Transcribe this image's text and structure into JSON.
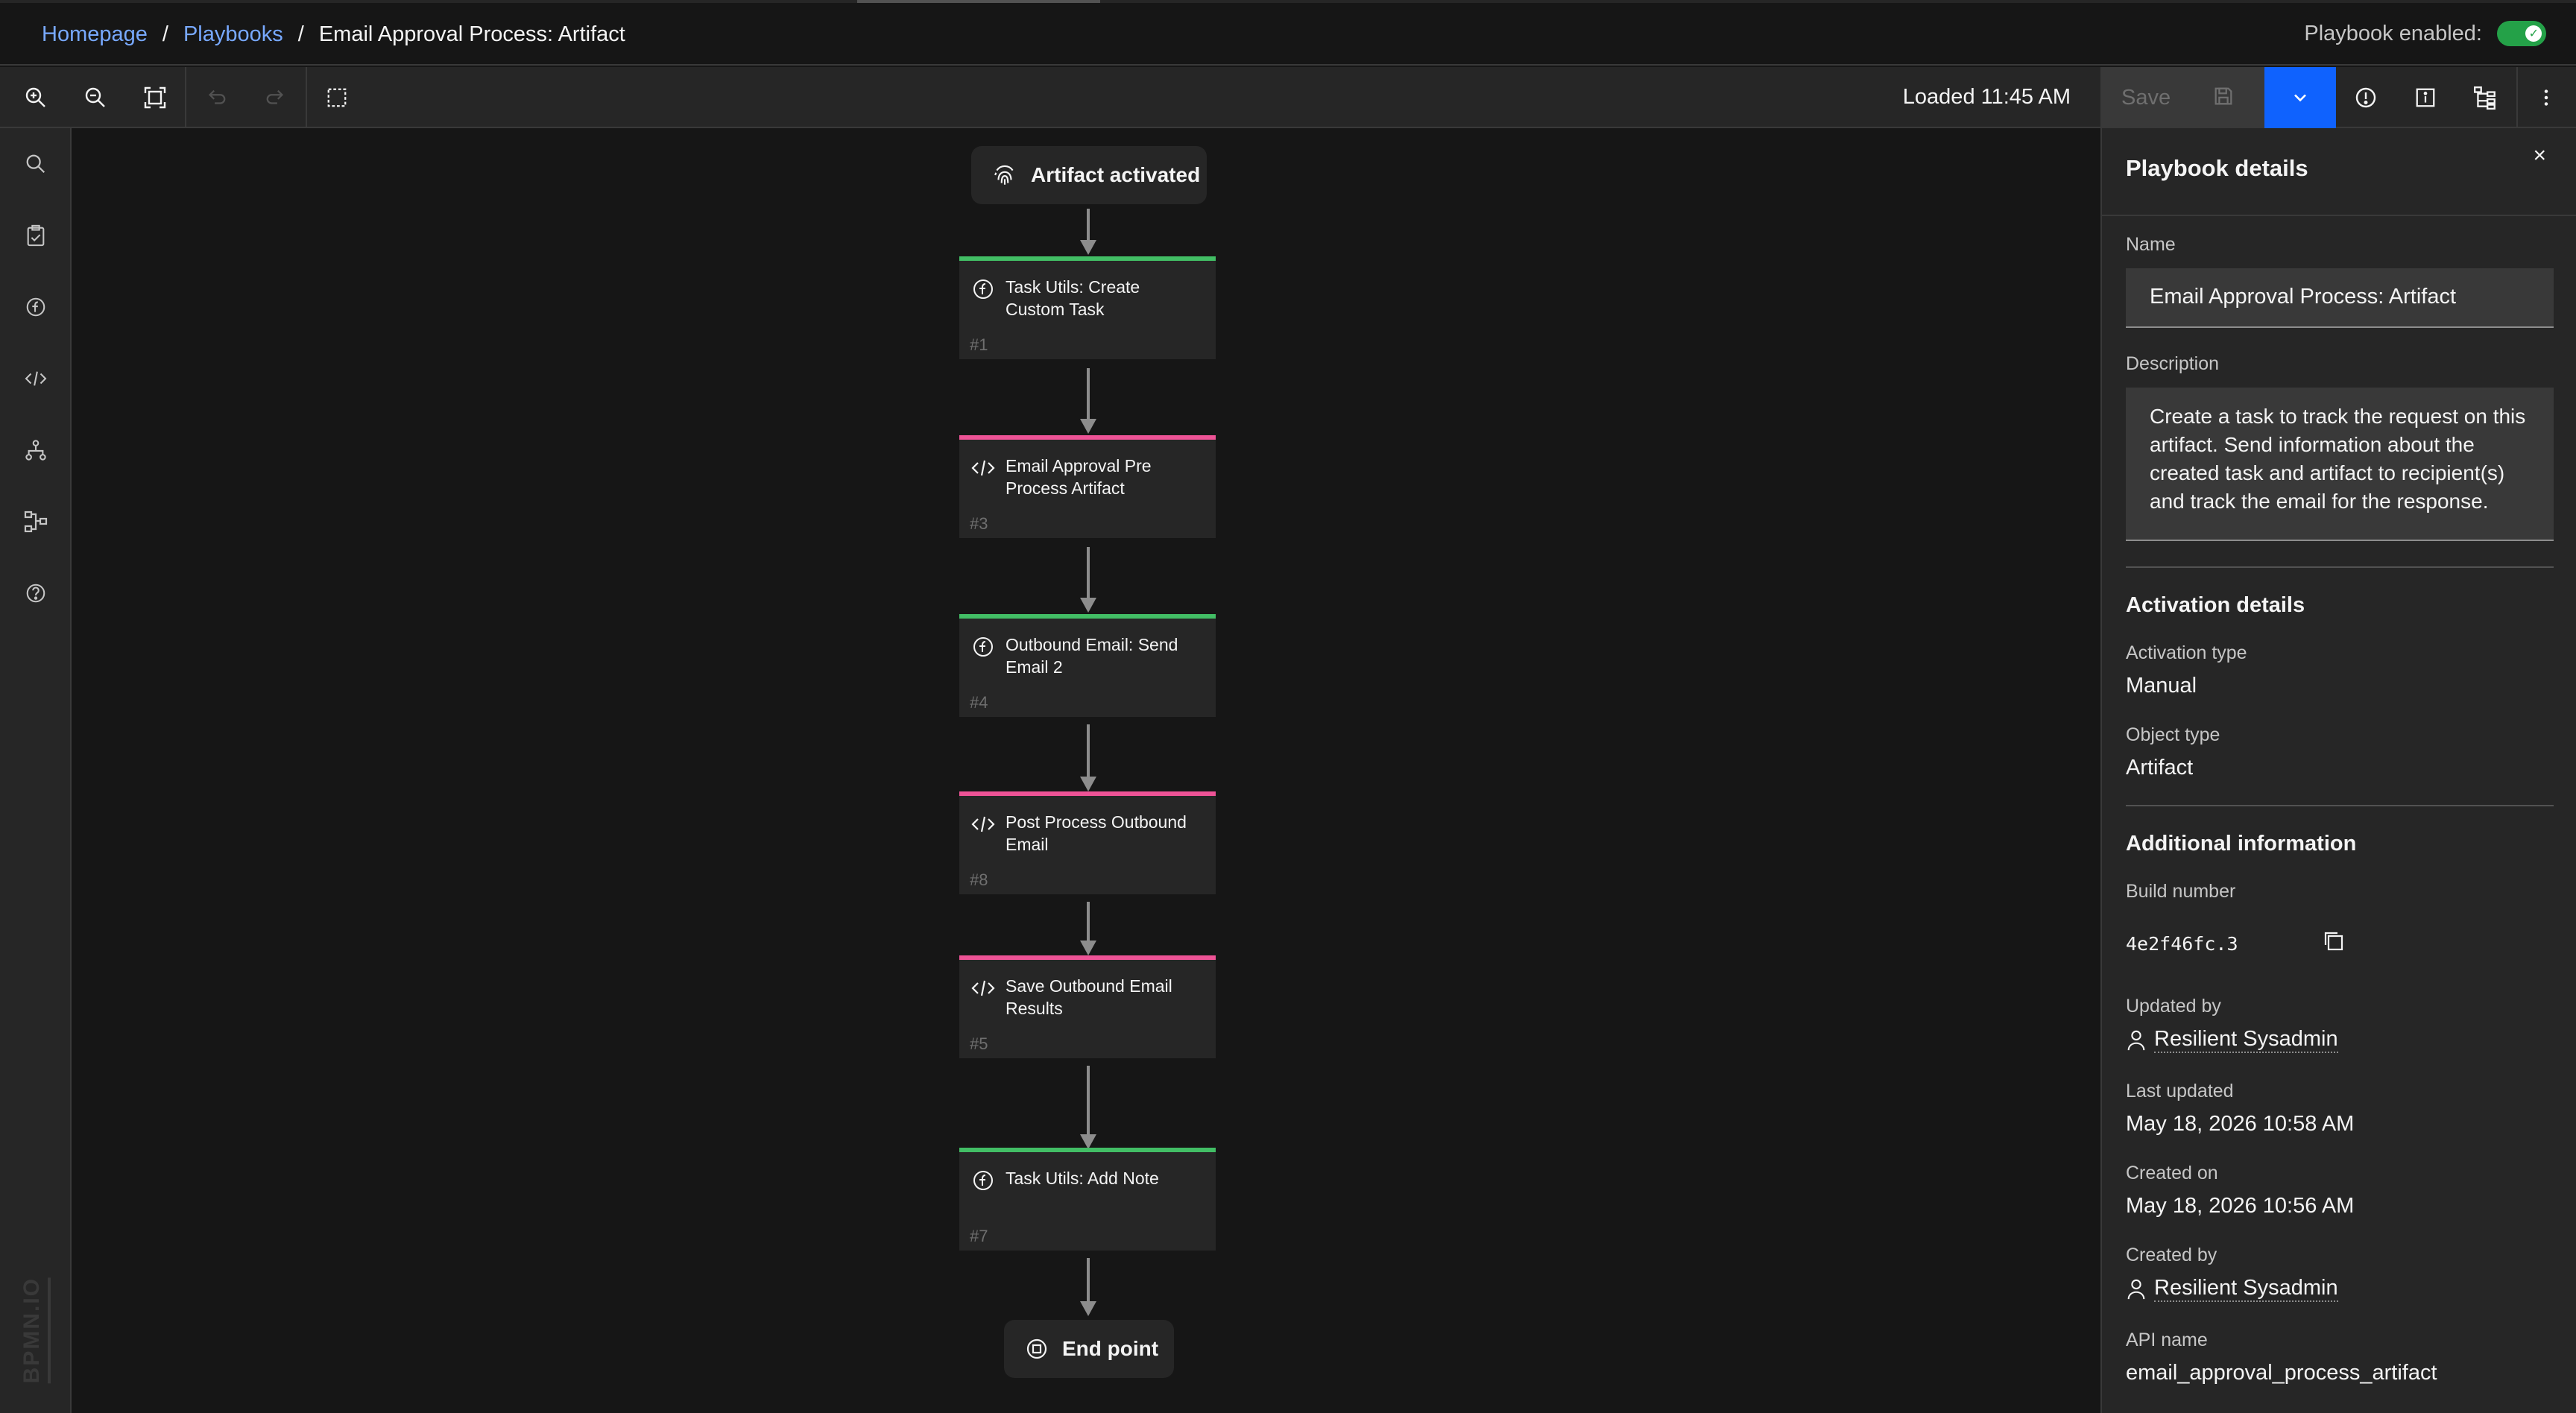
{
  "breadcrumb": {
    "home": "Homepage",
    "playbooks": "Playbooks",
    "current": "Email Approval Process: Artifact",
    "sep": "/"
  },
  "header": {
    "enabled_label": "Playbook enabled:",
    "enabled": true
  },
  "toolbar": {
    "loaded": "Loaded 11:45 AM",
    "save_label": "Save",
    "icons": [
      "zoom-in-icon",
      "zoom-out-icon",
      "fit-to-screen-icon",
      "undo-icon",
      "redo-icon",
      "select-area-icon",
      "warning-icon",
      "info-icon",
      "tree-view-icon",
      "overflow-menu-icon"
    ]
  },
  "leftbar": {
    "icons": [
      "search-icon",
      "task-icon",
      "function-icon",
      "script-icon",
      "workflow-icon",
      "subplaybook-icon",
      "help-icon"
    ],
    "watermark": "BPMN.IO"
  },
  "flow": {
    "trigger": "Artifact activated",
    "end": "End point",
    "nodes": [
      {
        "type": "function",
        "title": "Task Utils: Create Custom Task",
        "num": "#1"
      },
      {
        "type": "script",
        "title": "Email Approval Pre Process Artifact",
        "num": "#3"
      },
      {
        "type": "function",
        "title": "Outbound Email: Send Email 2",
        "num": "#4"
      },
      {
        "type": "script",
        "title": "Post Process Outbound Email",
        "num": "#8"
      },
      {
        "type": "script",
        "title": "Save Outbound Email Results",
        "num": "#5"
      },
      {
        "type": "function",
        "title": "Task Utils: Add Note",
        "num": "#7"
      }
    ]
  },
  "panel": {
    "title": "Playbook details",
    "close": "×",
    "name_label": "Name",
    "name_value": "Email Approval Process: Artifact",
    "desc_label": "Description",
    "desc_value": "Create a task to track the request on this artifact. Send information about the created task and artifact to recipient(s) and track the email for the response.",
    "activation_title": "Activation details",
    "activation_type_label": "Activation type",
    "activation_type": "Manual",
    "object_type_label": "Object type",
    "object_type": "Artifact",
    "additional_title": "Additional information",
    "build_label": "Build number",
    "build_value": "4e2f46fc.3",
    "updated_by_label": "Updated by",
    "updated_by": "Resilient Sysadmin",
    "last_updated_label": "Last updated",
    "last_updated": "May 18, 2026 10:58 AM",
    "created_on_label": "Created on",
    "created_on": "May 18, 2026 10:56 AM",
    "created_by_label": "Created by",
    "created_by": "Resilient Sysadmin",
    "api_label": "API name",
    "api_value": "email_approval_process_artifact"
  },
  "colors": {
    "function": "#42be65",
    "script": "#ee5396",
    "primary": "#0f62fe",
    "link": "#78a9ff"
  }
}
